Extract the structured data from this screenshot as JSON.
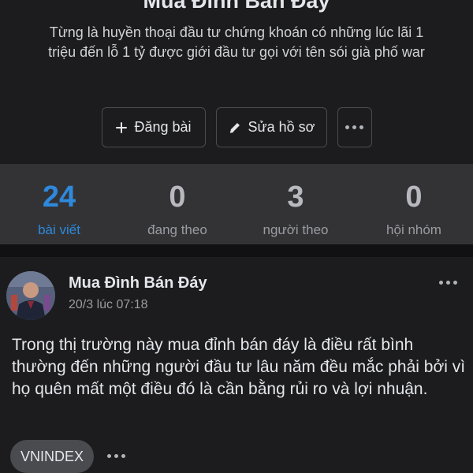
{
  "profile": {
    "name": "Mua Đỉnh Bán Đáy",
    "bio": "Từng là huyền thoại đầu tư chứng khoán có những lúc lãi 1 triệu đến lỗ 1 tỷ được giới đầu tư gọi với tên sói già phố war"
  },
  "actions": {
    "post_label": "Đăng bài",
    "edit_label": "Sửa hồ sơ",
    "post_icon": "plus-icon",
    "edit_icon": "pencil-icon",
    "more_icon": "more-dots-icon"
  },
  "stats": [
    {
      "count": "24",
      "label": "bài viết",
      "active": true
    },
    {
      "count": "0",
      "label": "đang theo",
      "active": false
    },
    {
      "count": "3",
      "label": "người theo",
      "active": false
    },
    {
      "count": "0",
      "label": "hội nhóm",
      "active": false
    }
  ],
  "post": {
    "author": "Mua Đình Bán Đáy",
    "timestamp": "20/3 lúc 07:18",
    "text": "Trong thị trường này mua đỉnh bán đáy là điều rất bình thường đến những người đầu tư lâu năm đều mắc phải bởi vì họ quên mất một điều đó là cần bằng rủi ro và lợi nhuận.",
    "tag": "VNINDEX"
  },
  "colors": {
    "background": "#1c1c1e",
    "stats_background": "#333336",
    "accent": "#2e89dc",
    "muted_text": "#9a9ca1"
  }
}
